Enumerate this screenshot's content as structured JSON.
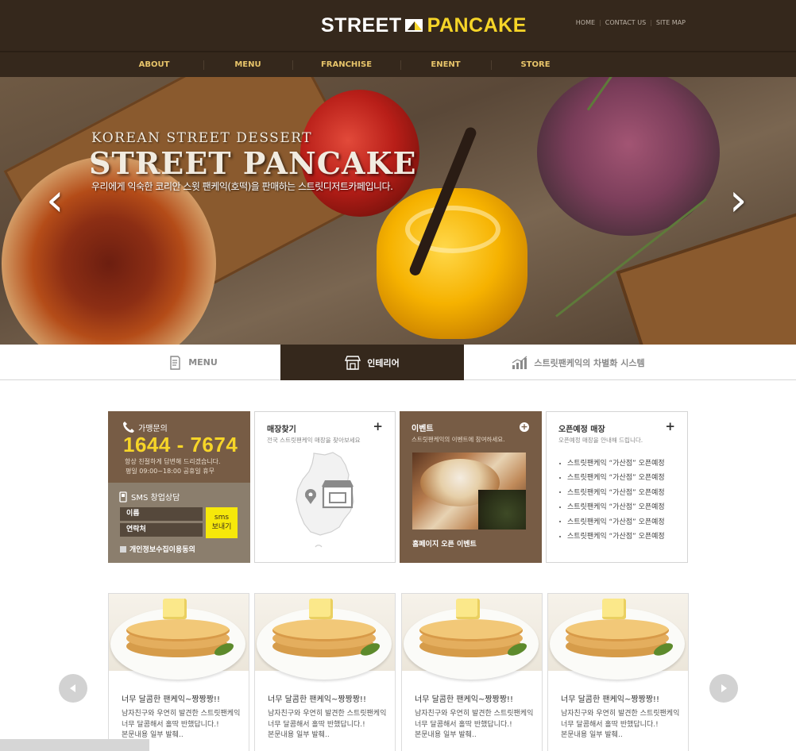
{
  "header": {
    "logo_word1": "STREET",
    "logo_word2": "PANCAKE",
    "top_links": [
      "HOME",
      "CONTACT US",
      "SITE MAP"
    ],
    "nav": [
      "ABOUT",
      "MENU",
      "FRANCHISE",
      "ENENT",
      "STORE"
    ]
  },
  "hero": {
    "subtitle": "KOREAN STREET DESSERT",
    "title": "STREET PANCAKE",
    "description": "우리에게 익숙한 코리안 스윗 팬케익(호떡)을 판매하는 스트릿디저트카페입니다.",
    "prev_glyph": "‹",
    "next_glyph": "›"
  },
  "tabs": {
    "menu": "MENU",
    "interior": "인테리어",
    "system": "스트릿팬케익의 차별화 시스템"
  },
  "contact_box": {
    "phone_label": "가맹문의",
    "phone_number": "1644 - 7674",
    "note1": "항상 친절하게 답변해 드리겠습니다.",
    "note2": "평일 09:00~18:00   공휴일 휴무",
    "sms_title": "SMS 창업상담",
    "name_field": "이름",
    "contact_field": "연락처",
    "send_line1": "sms",
    "send_line2": "보내기",
    "agree_label": "개인정보수집이용동의"
  },
  "store_box": {
    "title": "매장찾기",
    "subtitle": "전국 스트릿팬케익 매장을 찾아보세요",
    "plus": "+"
  },
  "event_box": {
    "title": "이벤트",
    "subtitle": "스트릿팬케익의 이벤트에 참여하세요.",
    "plus": "+",
    "caption": "홈페이지 오픈 이벤트"
  },
  "open_box": {
    "title": "오픈예정 매장",
    "subtitle": "오픈예정 매장을 안내해 드립니다.",
    "plus": "+",
    "items": [
      "스트릿팬케익 “가산점” 오픈예정",
      "스트릿팬케익 “가산점” 오픈예정",
      "스트릿팬케익 “가산점” 오픈예정",
      "스트릿팬케익 “가산점” 오픈예정",
      "스트릿팬케익 “가산점” 오픈예정",
      "스트릿팬케익 “가산점” 오픈예정"
    ]
  },
  "cards": [
    {
      "title": "너무 달콤한 팬케익~짱짱짱!!",
      "line1": "남자친구와 우연히 발견한 스트릿팬케익",
      "line2": "너무 달콤해서 홀딱 반했답니다.!",
      "line3": "본문내용 일부 발췌.."
    },
    {
      "title": "너무 달콤한 팬케익~짱짱짱!!",
      "line1": "남자친구와 우연히 발견한 스트릿팬케익",
      "line2": "너무 달콤해서 홀딱 반했답니다.!",
      "line3": "본문내용 일부 발췌.."
    },
    {
      "title": "너무 달콤한 팬케익~짱짱짱!!",
      "line1": "남자친구와 우연히 발견한 스트릿팬케익",
      "line2": "너무 달콤해서 홀딱 반했답니다.!",
      "line3": "본문내용 일부 발췌.."
    },
    {
      "title": "너무 달콤한 팬케익~짱짱짱!!",
      "line1": "남자친구와 우연히 발견한 스트릿팬케익",
      "line2": "너무 달콤해서 홀딱 반했답니다.!",
      "line3": "본문내용 일부 발췌.."
    }
  ],
  "colors": {
    "header_bg": "#35281c",
    "accent_yellow": "#f6d528",
    "nav_text": "#e7c46a",
    "brown_panel": "#775c45",
    "sms_button": "#f6e80a"
  },
  "icons": [
    "phone-icon",
    "mobile-icon",
    "menu-book-icon",
    "store-icon",
    "chart-icon",
    "plus-icon",
    "arrow-left-icon",
    "arrow-right-icon"
  ]
}
